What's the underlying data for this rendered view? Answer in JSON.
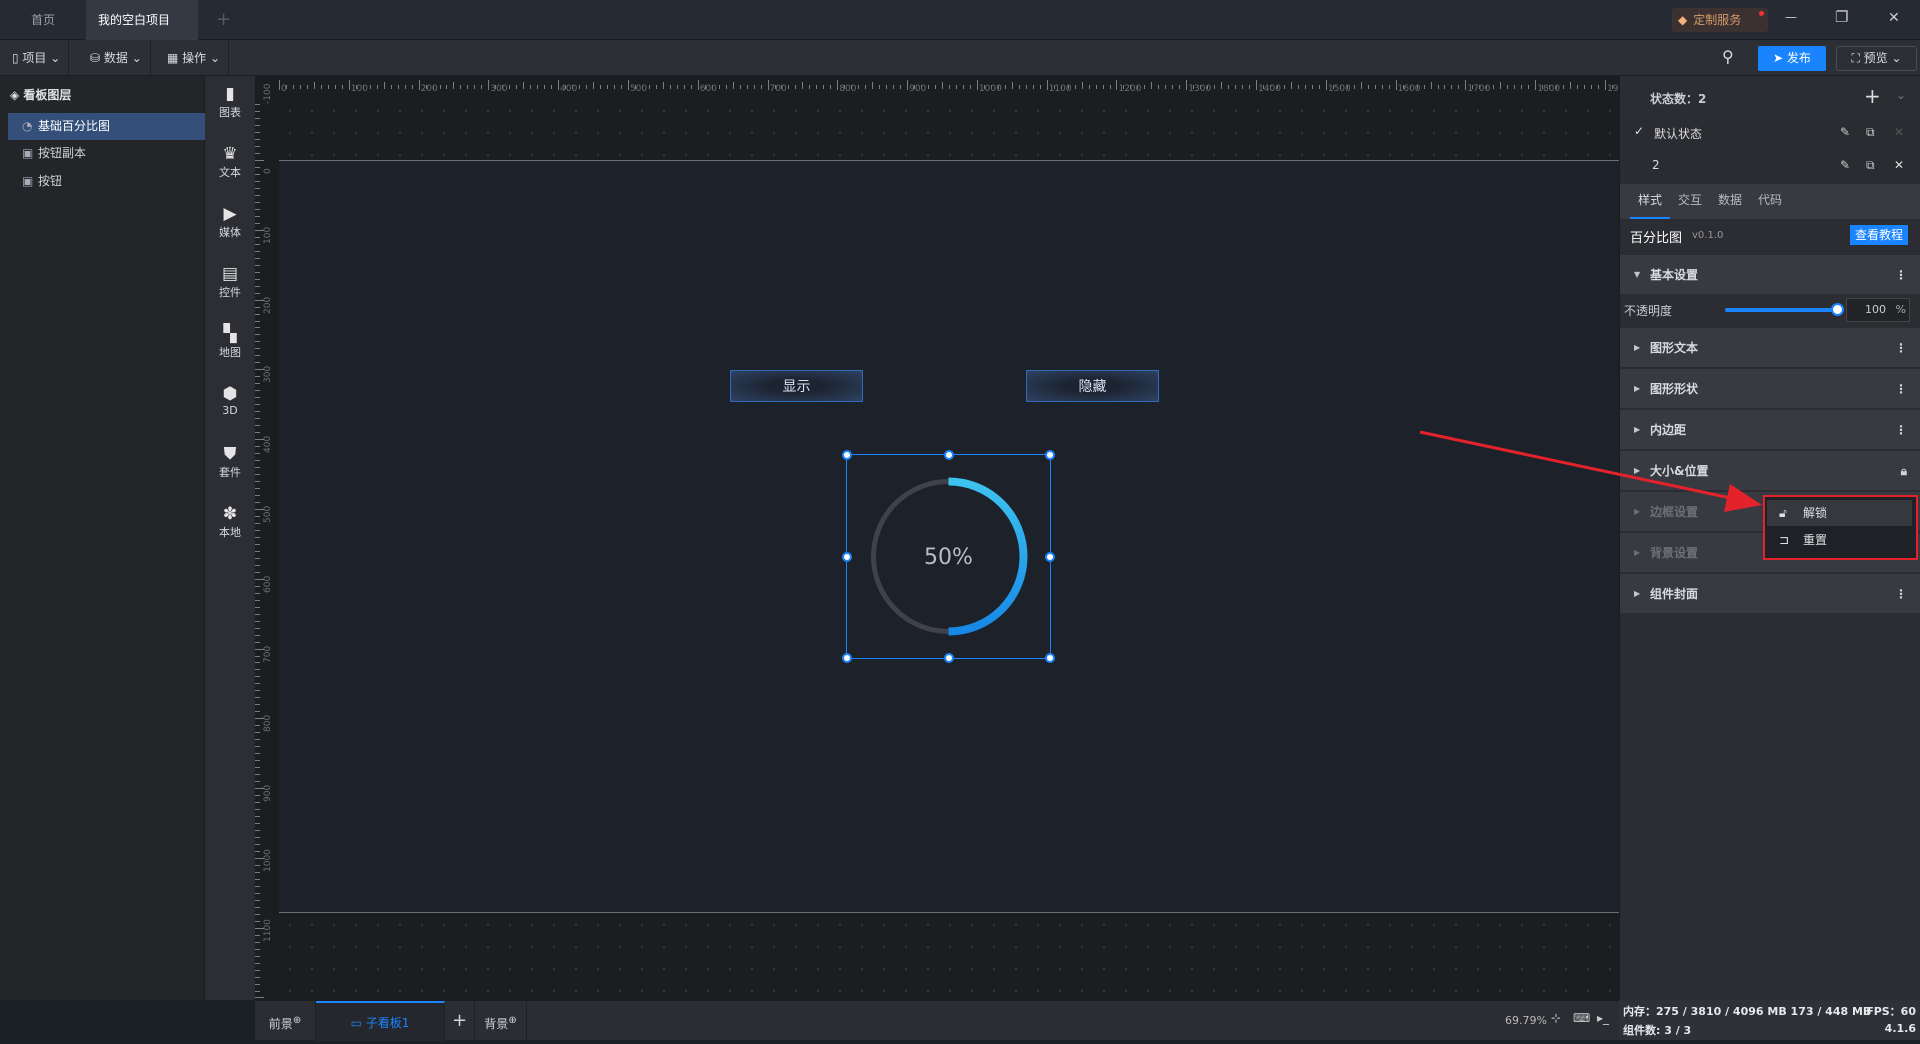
{
  "titlebar": {
    "tabs": [
      {
        "label": "首页"
      },
      {
        "label": "我的空白项目"
      }
    ],
    "add_tab": "+",
    "custom_service": "定制服务",
    "min": "—",
    "restore": "❐",
    "close": "✕"
  },
  "toolbar": {
    "menus": [
      {
        "label": "项目",
        "icon": "file-icon"
      },
      {
        "label": "数据",
        "icon": "database-icon"
      },
      {
        "label": "操作",
        "icon": "grid-icon"
      }
    ],
    "publish": "发布",
    "preview": "预览"
  },
  "layers": {
    "title": "看板图层",
    "items": [
      {
        "label": "基础百分比图",
        "selected": true
      },
      {
        "label": "按钮副本"
      },
      {
        "label": "按钮"
      }
    ]
  },
  "tools": [
    {
      "label": "图表",
      "icon": "chart-icon"
    },
    {
      "label": "文本",
      "icon": "text-icon"
    },
    {
      "label": "媒体",
      "icon": "media-icon"
    },
    {
      "label": "控件",
      "icon": "control-icon"
    },
    {
      "label": "地图",
      "icon": "map-icon"
    },
    {
      "label": "3D",
      "icon": "cube-icon"
    },
    {
      "label": "套件",
      "icon": "kit-icon"
    },
    {
      "label": "本地",
      "icon": "puzzle-icon"
    }
  ],
  "ruler": {
    "h_labels": [
      "0",
      "100",
      "200",
      "300",
      "400",
      "500",
      "600",
      "700",
      "800",
      "900",
      "1000",
      "1100",
      "1200",
      "1300",
      "1400",
      "1500",
      "1600",
      "1700",
      "1800",
      "1900"
    ],
    "v_labels": [
      "-100",
      "0",
      "100",
      "200",
      "300",
      "400",
      "500",
      "600",
      "700",
      "800",
      "900",
      "1000",
      "1100"
    ]
  },
  "canvas": {
    "show_button": "显示",
    "hide_button": "隐藏",
    "percent_text": "50%",
    "percent_value": 50,
    "track_color": "#3f424b",
    "arc_color_start": "#3ec3ef",
    "arc_color_end": "#1788e6",
    "selection_color": "#1a84ff"
  },
  "annotation": {
    "arrow_color": "#e3222b"
  },
  "right": {
    "states_label": "状态数：2",
    "states": [
      {
        "label": "默认状态",
        "checked": true
      },
      {
        "label": "2",
        "checked": false
      }
    ],
    "tabs": [
      "样式",
      "交互",
      "数据",
      "代码"
    ],
    "active_tab": "样式",
    "component_name": "百分比图",
    "component_version": "v0.1.0",
    "tutorial": "查看教程",
    "basic": "基本设置",
    "opacity_label": "不透明度",
    "opacity_value": "100",
    "opacity_unit": "%",
    "opacity_fraction": 1.0,
    "sections": [
      {
        "label": "图形文本"
      },
      {
        "label": "图形形状"
      },
      {
        "label": "内边距"
      },
      {
        "label": "大小&位置",
        "locked": true
      },
      {
        "label": "边框设置",
        "dim": true
      },
      {
        "label": "背景设置",
        "dim": true
      },
      {
        "label": "组件封面"
      }
    ],
    "popup": [
      {
        "label": "解锁",
        "icon": "unlock-icon"
      },
      {
        "label": "重置",
        "icon": "reset-icon"
      }
    ]
  },
  "bottom": {
    "foreground": "前景",
    "board": "子看板1",
    "add": "+",
    "background": "背景",
    "zoom": "69.79%"
  },
  "status": {
    "memory": "内存：275 / 3810 / 4096 MB  173 / 448 MB",
    "fps": "FPS：60",
    "components": "组件数: 3 / 3",
    "version": "4.1.6"
  }
}
